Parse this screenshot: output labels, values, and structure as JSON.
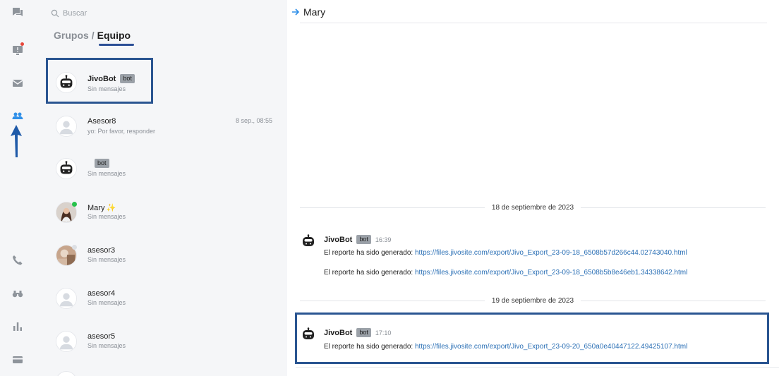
{
  "rail": {
    "items": [
      {
        "icon": "chat-bubbles-icon",
        "active": false
      },
      {
        "icon": "monitor-alert-icon",
        "active": false,
        "notification": true
      },
      {
        "icon": "mail-icon",
        "active": false
      },
      {
        "icon": "team-icon",
        "active": true
      },
      {
        "icon": "phone-icon",
        "active": false
      },
      {
        "icon": "binoculars-icon",
        "active": false
      },
      {
        "icon": "bar-chart-icon",
        "active": false
      },
      {
        "icon": "credit-card-icon",
        "active": false
      }
    ],
    "accent": "#2f8fe8"
  },
  "list": {
    "search_placeholder": "Buscar",
    "tabs": {
      "grupos": "Grupos",
      "separator": "/",
      "equipo": "Equipo"
    },
    "contacts": [
      {
        "name": "JivoBot",
        "badge": "bot",
        "subtitle": "Sin mensajes",
        "time": "",
        "avatar": "robot"
      },
      {
        "name": "Asesor8",
        "badge": "",
        "subtitle": "yo: Por favor, responder",
        "time": "8 sep., 08:55",
        "avatar": "default"
      },
      {
        "name": "",
        "badge": "bot",
        "subtitle": "Sin mensajes",
        "time": "",
        "avatar": "robot"
      },
      {
        "name": "Mary",
        "badge": "",
        "sparkle": "✨",
        "subtitle": "Sin mensajes",
        "time": "",
        "avatar": "photo",
        "status": "online"
      },
      {
        "name": "asesor3",
        "badge": "",
        "subtitle": "Sin mensajes",
        "time": "",
        "avatar": "photo2"
      },
      {
        "name": "asesor4",
        "badge": "",
        "subtitle": "Sin mensajes",
        "time": "",
        "avatar": "default"
      },
      {
        "name": "asesor5",
        "badge": "",
        "subtitle": "Sin mensajes",
        "time": "",
        "avatar": "default"
      }
    ]
  },
  "chat": {
    "title": "Mary",
    "dates": [
      "18 de septiembre de 2023",
      "19 de septiembre de 2023"
    ],
    "messages": [
      {
        "sender": "JivoBot",
        "badge": "bot",
        "time": "16:39",
        "lines": [
          {
            "prefix": "El reporte ha sido generado: ",
            "link": "https://files.jivosite.com/export/Jivo_Export_23-09-18_6508b57d266c44.02743040.html"
          },
          {
            "prefix": "El reporte ha sido generado: ",
            "link": "https://files.jivosite.com/export/Jivo_Export_23-09-18_6508b5b8e46eb1.34338642.html"
          }
        ]
      },
      {
        "sender": "JivoBot",
        "badge": "bot",
        "time": "17:10",
        "lines": [
          {
            "prefix": "El reporte ha sido generado: ",
            "link": "https://files.jivosite.com/export/Jivo_Export_23-09-20_650a0e40447122.49425107.html"
          }
        ]
      }
    ]
  },
  "colors": {
    "link": "#2a6fb5",
    "highlight": "#2a5591",
    "online": "#27c24c",
    "offline": "#dcdfe4"
  }
}
